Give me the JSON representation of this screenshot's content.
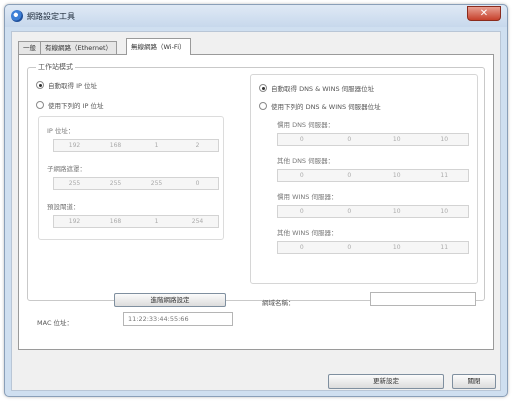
{
  "window": {
    "title": "網路設定工具",
    "close_glyph": "✕"
  },
  "tabs": [
    "一般",
    "有線網路（Ethernet）",
    "無線網路（Wi-Fi）"
  ],
  "mode_group": {
    "title": "工作站模式"
  },
  "ip": {
    "auto_label": "自動取得 IP 位址",
    "manual_label": "使用下列的 IP 位址",
    "ip_address_label": "IP 位址：",
    "ip_address": [
      "192",
      "168",
      "1",
      "2"
    ],
    "subnet_label": "子網路遮罩：",
    "subnet": [
      "255",
      "255",
      "255",
      "0"
    ],
    "gateway_label": "預設閘道：",
    "gateway": [
      "192",
      "168",
      "1",
      "254"
    ]
  },
  "dns": {
    "auto_label": "自動取得 DNS & WINS 伺服器位址",
    "manual_label": "使用下列的 DNS & WINS 伺服器位址",
    "pref_dns_label": "慣用 DNS 伺服器：",
    "pref_dns": [
      "0",
      "0",
      "10",
      "10"
    ],
    "alt_dns_label": "其他 DNS 伺服器：",
    "alt_dns": [
      "0",
      "0",
      "10",
      "11"
    ],
    "pref_wins_label": "慣用 WINS 伺服器：",
    "pref_wins": [
      "0",
      "0",
      "10",
      "10"
    ],
    "alt_wins_label": "其他 WINS 伺服器：",
    "alt_wins": [
      "0",
      "0",
      "10",
      "11"
    ],
    "domain_label": "網域名稱：",
    "domain_value": ""
  },
  "buttons": {
    "advanced": "進階網路設定",
    "update": "更新設定",
    "close": "關閉"
  },
  "mac": {
    "label": "MAC 位址：",
    "value": "11:22:33:44:55:66"
  }
}
